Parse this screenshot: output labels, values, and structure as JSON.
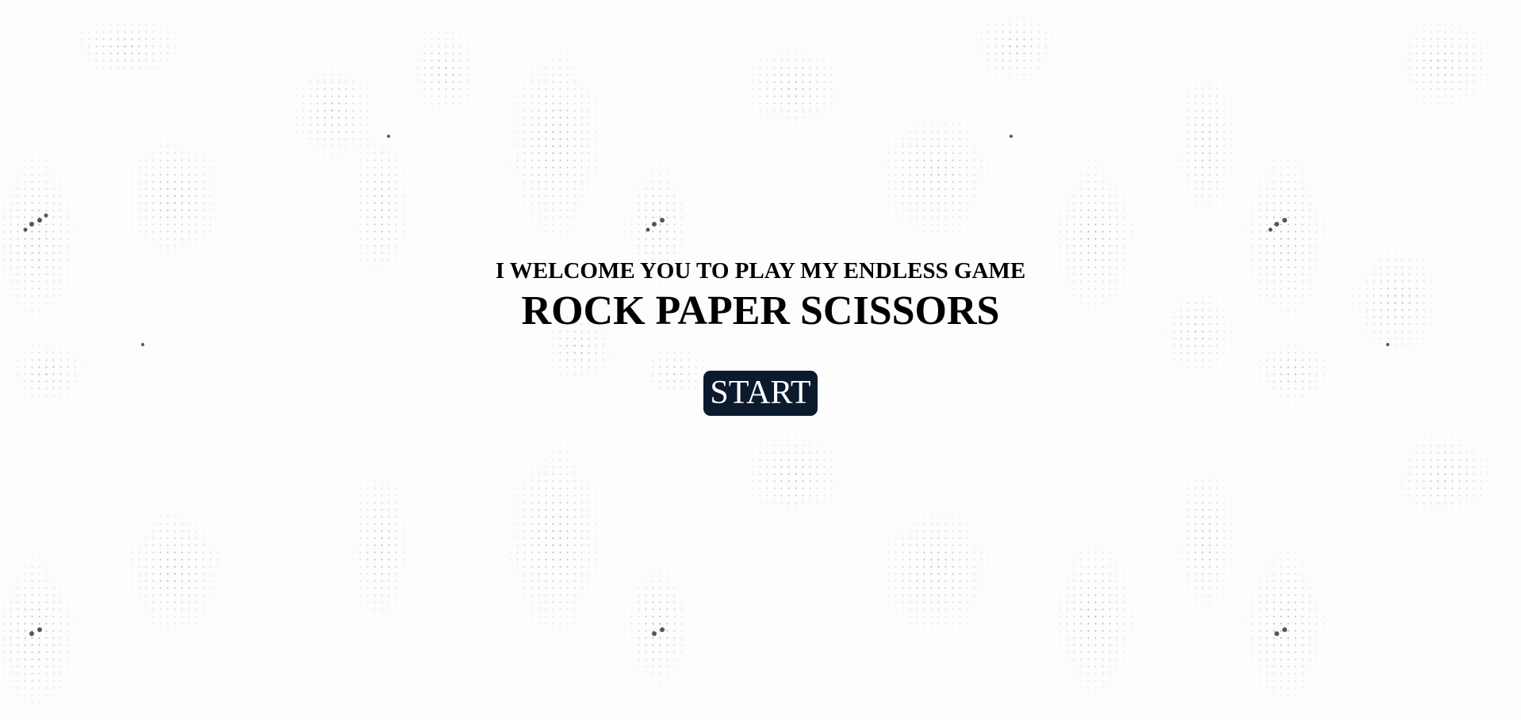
{
  "intro": {
    "welcome_text": "I WELCOME YOU TO PLAY MY ENDLESS GAME",
    "title": "ROCK PAPER SCISSORS"
  },
  "actions": {
    "start_label": "START"
  },
  "colors": {
    "background": "#fdfdfd",
    "button_background": "#0c1a2e",
    "button_text": "#ffffff",
    "text": "#000000"
  }
}
